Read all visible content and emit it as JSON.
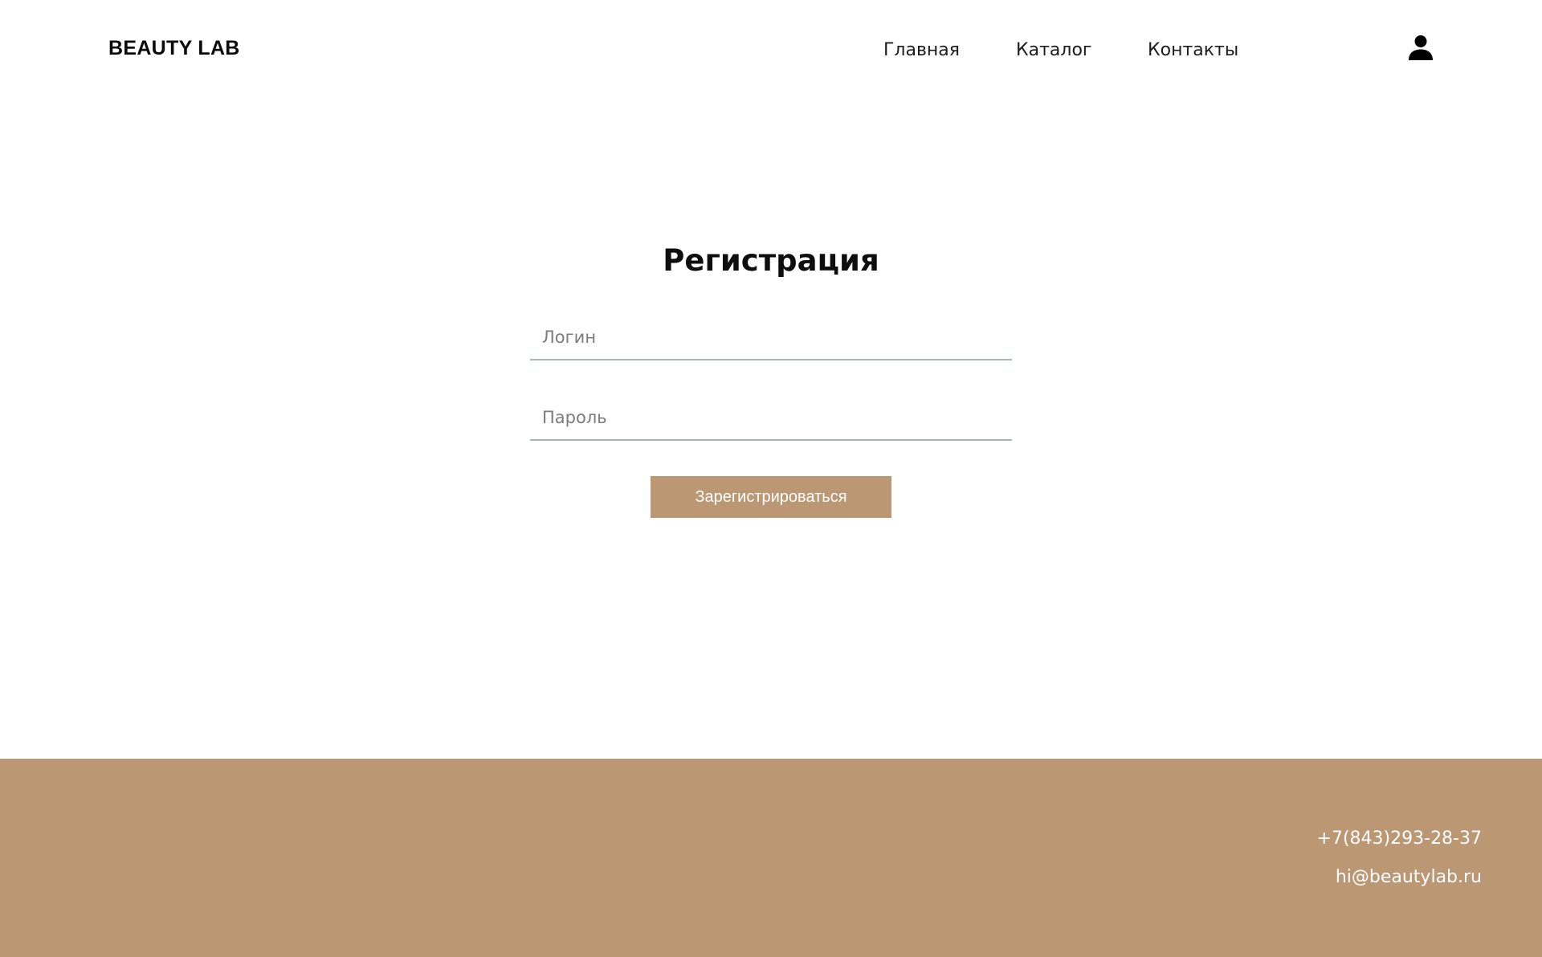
{
  "header": {
    "logo": "BEAUTY LAB",
    "nav": [
      {
        "label": "Главная"
      },
      {
        "label": "Каталог"
      },
      {
        "label": "Контакты"
      }
    ],
    "profile_icon": "user-icon"
  },
  "register": {
    "title": "Регистрация",
    "login_placeholder": "Логин",
    "login_value": "",
    "password_placeholder": "Пароль",
    "password_value": "",
    "submit_label": "Зарегистрироваться"
  },
  "footer": {
    "phone": "+7(843)293-28-37",
    "email": "hi@beautylab.ru"
  },
  "colors": {
    "accent": "#bb9773",
    "text": "#111111",
    "background": "#ffffff",
    "field_border": "#a9b3c0"
  }
}
